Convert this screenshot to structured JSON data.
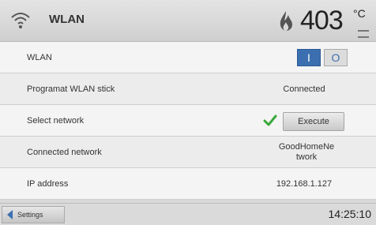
{
  "header": {
    "title": "WLAN",
    "temperature": "403",
    "temperature_unit": "°C",
    "wifi_icon": "wifi-icon",
    "flame_icon": "flame-icon"
  },
  "rows": [
    {
      "label": "WLAN",
      "toggle_on": "I",
      "toggle_off": "O"
    },
    {
      "label": "Programat WLAN stick",
      "value": "Connected"
    },
    {
      "label": "Select network",
      "button": "Execute",
      "check_icon": "check-icon"
    },
    {
      "label": "Connected network",
      "value": "GoodHomeNetwork"
    },
    {
      "label": "IP address",
      "value": "192.168.1.127"
    }
  ],
  "footer": {
    "settings_label": "Settings",
    "time": "14:25:10"
  },
  "colors": {
    "accent": "#3b6fb0",
    "check": "#3aa83a"
  }
}
